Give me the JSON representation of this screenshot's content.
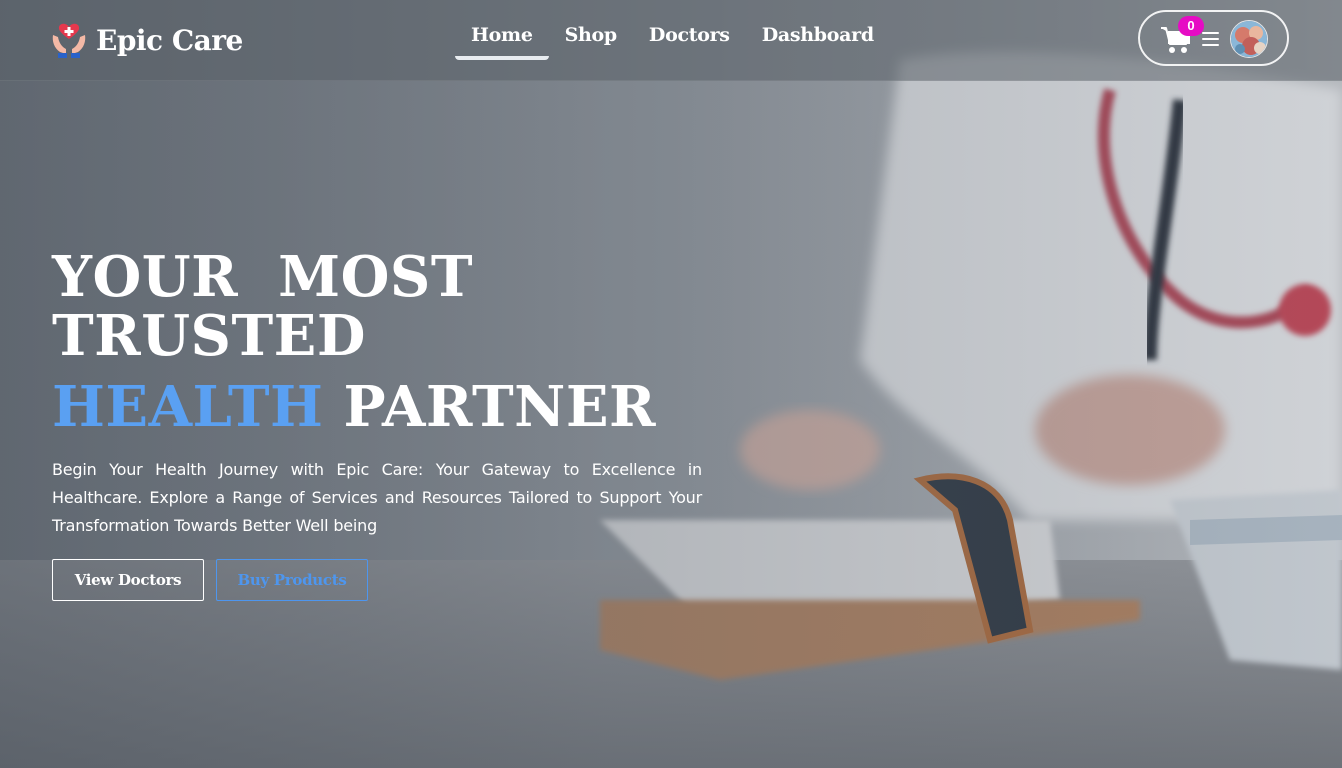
{
  "brand": {
    "name": "Epic Care",
    "logo_icon": "caring-hands-heart-icon"
  },
  "nav": {
    "links": [
      {
        "label": "Home",
        "active": true
      },
      {
        "label": "Shop",
        "active": false
      },
      {
        "label": "Doctors",
        "active": false
      },
      {
        "label": "Dashboard",
        "active": false
      }
    ]
  },
  "actions": {
    "cart_icon": "shopping-cart-icon",
    "cart_count": "0",
    "menu_icon": "hamburger-menu-icon",
    "avatar_icon": "user-avatar"
  },
  "hero": {
    "title_line_1": "YOUR  MOST",
    "title_line_2": "TRUSTED",
    "title_accent": "HEALTH",
    "title_rest": "PARTNER",
    "description": "Begin Your Health Journey with Epic Care: Your Gateway to Excellence in Healthcare. Explore a Range of Services and Resources Tailored to Support Your Transformation Towards Better Well being",
    "primary_button": "View Doctors",
    "secondary_button": "Buy Products"
  },
  "colors": {
    "accent": "#5aa0f2",
    "badge": "#e60cc4",
    "secondary_button": "#4e96ee"
  }
}
